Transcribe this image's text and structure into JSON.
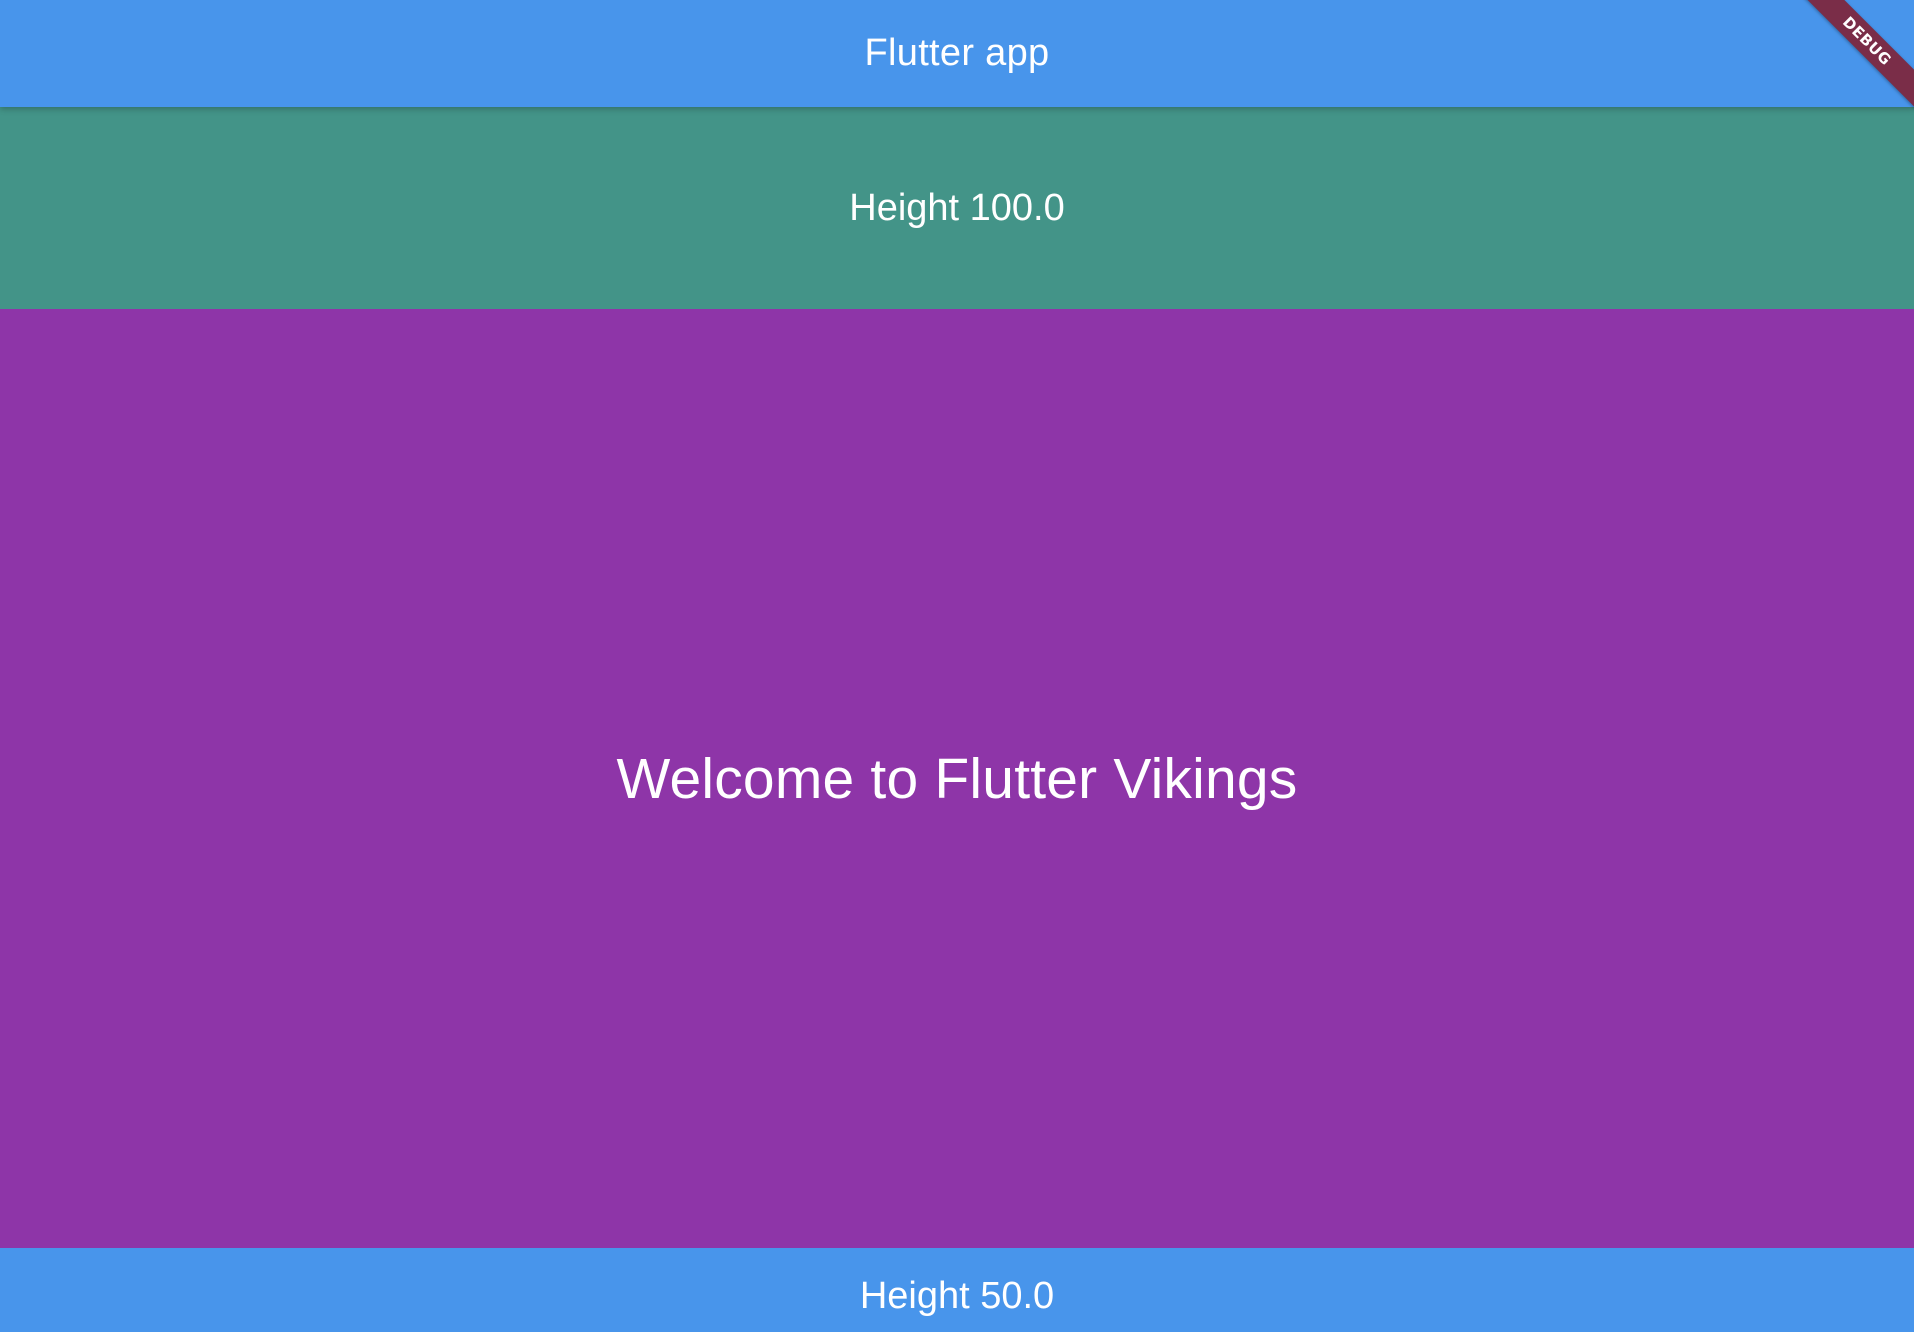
{
  "app_bar": {
    "title": "Flutter app"
  },
  "top_panel": {
    "label": "Height 100.0"
  },
  "middle_panel": {
    "welcome": "Welcome to Flutter Vikings"
  },
  "bottom_panel": {
    "label": "Height 50.0"
  },
  "debug_banner": {
    "text": "DEBUG"
  },
  "colors": {
    "app_bar": "#4895eb",
    "top_panel": "#439488",
    "middle_panel": "#8e35a8",
    "bottom_panel": "#4895eb",
    "debug_banner": "#7a2d48",
    "text": "#ffffff"
  }
}
